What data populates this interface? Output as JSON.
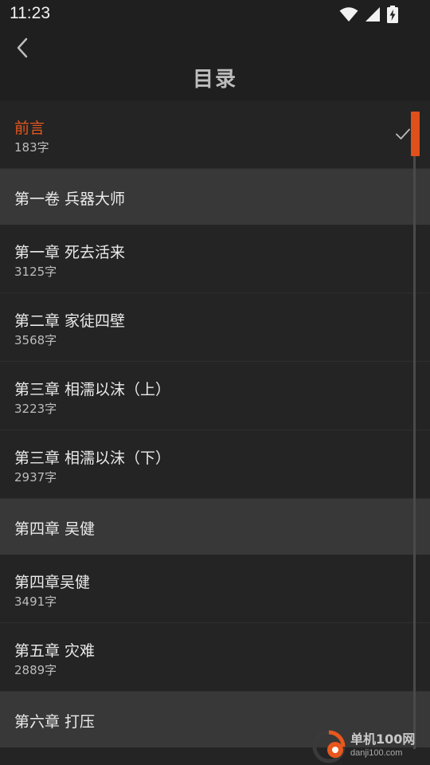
{
  "status": {
    "time": "11:23",
    "icons": [
      "wifi-icon",
      "signal-icon",
      "battery-charging-icon"
    ]
  },
  "header": {
    "back_icon": "chevron-left-icon",
    "title": "目录"
  },
  "toc": {
    "items": [
      {
        "type": "chapter",
        "title": "前言",
        "count": "183字",
        "current": true
      },
      {
        "type": "volume",
        "title": "第一卷 兵器大师"
      },
      {
        "type": "chapter",
        "title": "第一章 死去活来",
        "count": "3125字"
      },
      {
        "type": "chapter",
        "title": "第二章 家徒四壁",
        "count": "3568字"
      },
      {
        "type": "chapter",
        "title": "第三章 相濡以沫（上）",
        "count": "3223字"
      },
      {
        "type": "chapter",
        "title": "第三章 相濡以沫（下）",
        "count": "2937字"
      },
      {
        "type": "volume",
        "title": "第四章 吴健"
      },
      {
        "type": "chapter",
        "title": "第四章吴健",
        "count": "3491字"
      },
      {
        "type": "chapter",
        "title": "第五章 灾难",
        "count": "2889字"
      },
      {
        "type": "volume",
        "title": "第六章 打压"
      }
    ]
  },
  "watermark": {
    "name": "单机100网",
    "url": "danji100.com"
  },
  "colors": {
    "accent": "#e8571d",
    "background": "#242424",
    "volume_bg": "#383838",
    "bar_bg": "#1f1f1f"
  }
}
